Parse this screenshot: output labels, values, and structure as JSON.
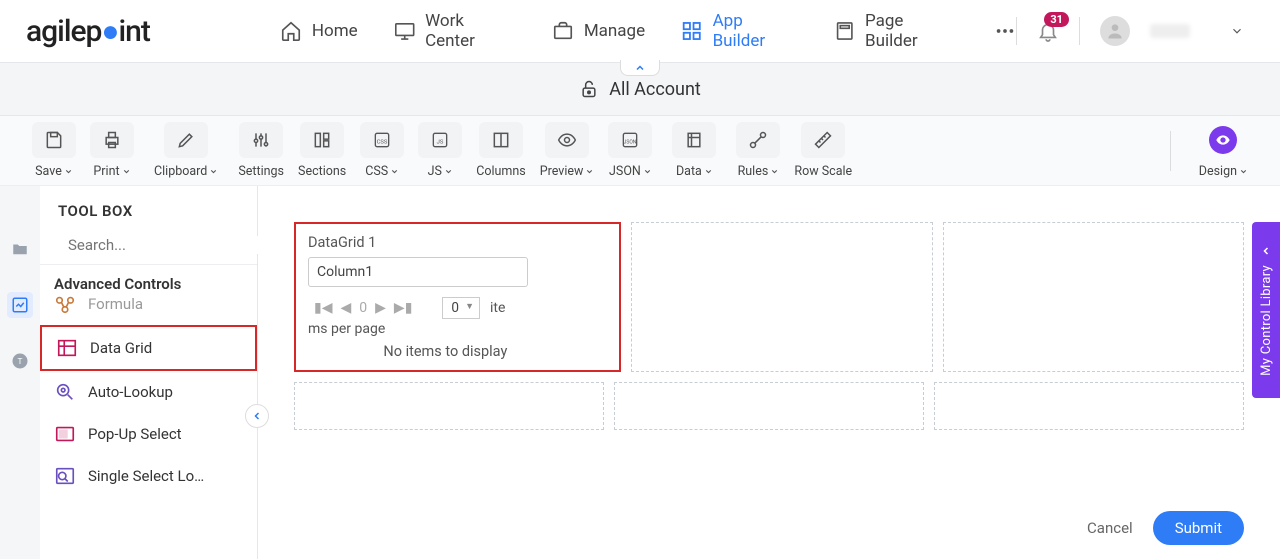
{
  "logo": {
    "text_pre": "agilep",
    "text_post": "int"
  },
  "nav": {
    "items": [
      {
        "label": "Home"
      },
      {
        "label": "Work Center"
      },
      {
        "label": "Manage"
      },
      {
        "label": "App Builder"
      },
      {
        "label": "Page Builder"
      }
    ],
    "notification_count": "31"
  },
  "context": {
    "title": "All Account"
  },
  "toolbar": {
    "save": "Save",
    "print": "Print",
    "clipboard": "Clipboard",
    "settings": "Settings",
    "sections": "Sections",
    "css": "CSS",
    "js": "JS",
    "columns": "Columns",
    "preview": "Preview",
    "json": "JSON",
    "data": "Data",
    "rules": "Rules",
    "rowscale": "Row Scale",
    "design": "Design"
  },
  "toolbox": {
    "header": "TOOL BOX",
    "search_placeholder": "Search...",
    "section": "Advanced Controls",
    "items": [
      {
        "label": "Formula"
      },
      {
        "label": "Data Grid"
      },
      {
        "label": "Auto-Lookup"
      },
      {
        "label": "Pop-Up Select"
      },
      {
        "label": "Single Select Lo…"
      }
    ]
  },
  "widget": {
    "title": "DataGrid 1",
    "column": "Column1",
    "page_current": "0",
    "page_size": "0",
    "items_label_1": "ite",
    "items_label_2": "ms per page",
    "empty": "No items to display"
  },
  "actions": {
    "cancel": "Cancel",
    "submit": "Submit"
  },
  "side_tab": {
    "label": "My Control Library"
  }
}
